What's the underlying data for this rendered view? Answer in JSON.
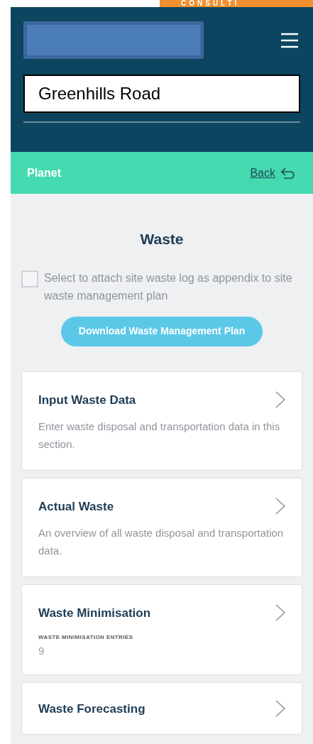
{
  "banner": {
    "text": "CONSULTI"
  },
  "header": {
    "site_field": {
      "value": "Greenhills Road"
    }
  },
  "nav_bar": {
    "title": "Planet",
    "back_link": "Back"
  },
  "page": {
    "title": "Waste",
    "attach_option": {
      "label": "Select to attach site waste log as appendix to site waste management plan",
      "checked": false
    },
    "download_button": "Download Waste Management Plan",
    "cards": [
      {
        "kind": "description",
        "title": "Input Waste Data",
        "text": "Enter waste disposal and transportation data in this section."
      },
      {
        "kind": "description",
        "title": "Actual Waste",
        "text": "An overview of all waste disposal and transportation data."
      },
      {
        "kind": "stat",
        "title": "Waste Minimisation",
        "stat_label": "WASTE MINIMISATION ENTRIES",
        "stat_value": "9"
      },
      {
        "kind": "plain",
        "title": "Waste Forecasting"
      }
    ]
  }
}
